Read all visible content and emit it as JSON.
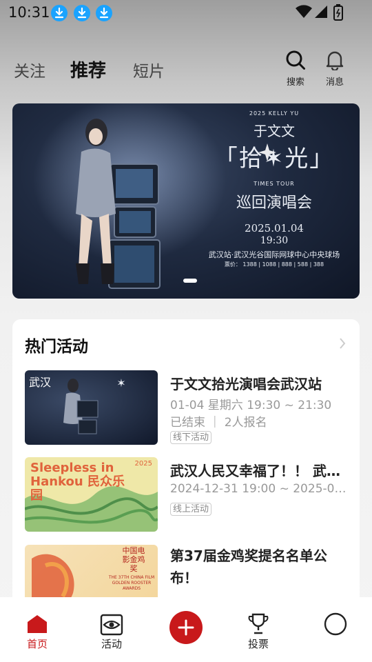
{
  "status_bar": {
    "time": "10:31"
  },
  "top_tabs": [
    {
      "label": "关注"
    },
    {
      "label": "推荐"
    },
    {
      "label": "短片"
    }
  ],
  "top_actions": {
    "search_label": "搜索",
    "messages_label": "消息"
  },
  "banner": {
    "line1": "2025 KELLY YU",
    "artist": "于文文",
    "title": "「拾✶光」",
    "tour": "TIMES TOUR",
    "subtitle": "巡回演唱会",
    "date": "2025.01.04",
    "time": "19:30",
    "venue": "武汉站·武汉光谷国际网球中心中央球场",
    "prices": "票价： 1388 | 1088 | 888 | 588 | 388"
  },
  "hot": {
    "title": "热门活动",
    "items": [
      {
        "thumb_caption": "武汉",
        "title": "于文文拾光演唱会武汉站",
        "meta1": "01-04 星期六 19:30 ~ 21:30",
        "meta2": "已结束 ｜ 2人报名",
        "tag": "线下活动"
      },
      {
        "thumb_caption": "Sleepless in Hankou  民众乐园",
        "thumb_year": "2025",
        "title": "武汉人民又幸福了！！ 武汉…",
        "meta1": "2024-12-31 19:00 ~ 2025-01-0…",
        "tag": "线上活动"
      },
      {
        "thumb_caption": "中国电影金鸡奖",
        "thumb_sub": "THE 37TH CHINA FILM GOLDEN ROOSTER AWARDS",
        "title": "第37届金鸡奖提名名单公布！",
        "tag": ""
      }
    ]
  },
  "bottom_nav": [
    {
      "label": "首页"
    },
    {
      "label": "活动"
    },
    {
      "label": ""
    },
    {
      "label": "投票"
    },
    {
      "label": ""
    }
  ],
  "colors": {
    "accent": "#c8191b",
    "download_badge": "#1aa3ff"
  }
}
